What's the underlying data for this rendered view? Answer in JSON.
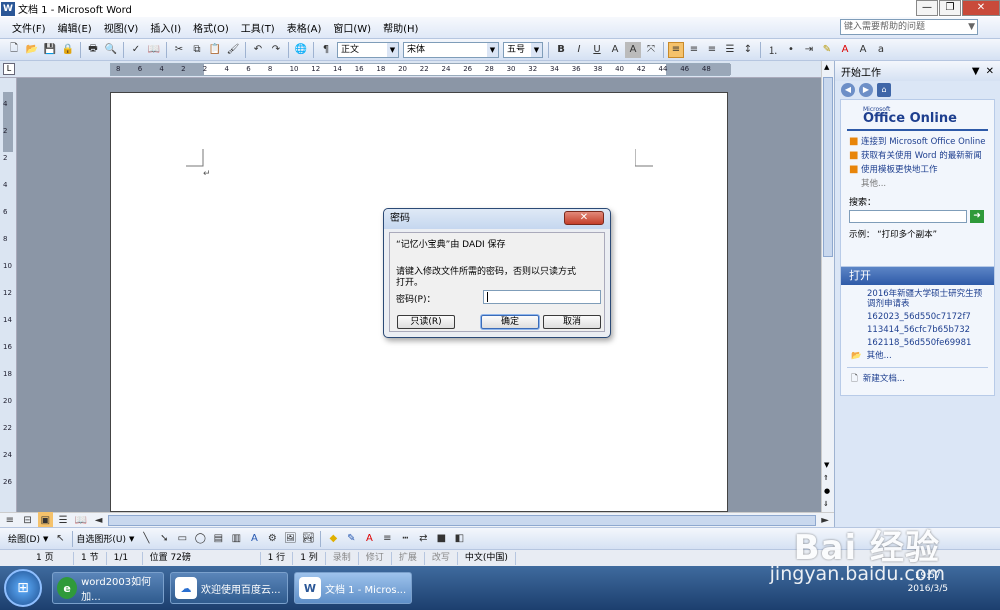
{
  "titlebar": {
    "icon_letter": "W",
    "title": "文档 1 - Microsoft Word"
  },
  "window_controls": {
    "minimize": "—",
    "restore": "❐",
    "close": "✕"
  },
  "menubar": {
    "items": [
      "文件(F)",
      "编辑(E)",
      "视图(V)",
      "插入(I)",
      "格式(O)",
      "工具(T)",
      "表格(A)",
      "窗口(W)",
      "帮助(H)"
    ],
    "help_placeholder": "键入需要帮助的问题"
  },
  "formatting": {
    "style": "正文",
    "font": "宋体",
    "size": "五号"
  },
  "ruler": {
    "h_ticks": [
      "8",
      "6",
      "4",
      "2",
      "2",
      "4",
      "6",
      "8",
      "10",
      "12",
      "14",
      "16",
      "18",
      "20",
      "22",
      "24",
      "26",
      "28",
      "30",
      "32",
      "34",
      "36",
      "38",
      "40",
      "42",
      "44",
      "46",
      "48"
    ]
  },
  "dialog": {
    "title": "密码",
    "line1": "“记忆小宝典”由 DADI 保存",
    "line2": "请键入修改文件所需的密码，否则以只读方式",
    "line3": "打开。",
    "password_label": "密码(P)：",
    "password_value": "",
    "readonly_button": "只读(R)",
    "ok_button": "确定",
    "cancel_button": "取消"
  },
  "taskpane": {
    "title": "开始工作",
    "office_brand_small": "Microsoft",
    "office_brand": "Office Online",
    "links": [
      "连接到 Microsoft Office Online",
      "获取有关使用 Word 的最新新闻",
      "使用模板更快地工作"
    ],
    "more": "其他...",
    "search_label": "搜索：",
    "example": "示例：  “打印多个副本”",
    "open_header": "打开",
    "recent_files": [
      "2016年新疆大学硕士研究生预调剂申请表",
      "162023_56d550c7172f7",
      "113414_56cfc7b65b732",
      "162118_56d550fe69981"
    ],
    "open_more": "其他...",
    "new_doc": "新建文档..."
  },
  "drawbar": {
    "draw": "绘图(D)",
    "autoshapes": "自选图形(U)"
  },
  "statusbar": {
    "page": "1 页",
    "section": "1 节",
    "pages": "1/1",
    "position": "位置 72磅",
    "line": "1 行",
    "col": "1 列",
    "rec": "录制",
    "trk": "修订",
    "ext": "扩展",
    "ovr": "改写",
    "lang": "中文(中国)"
  },
  "taskbar": {
    "tasks": [
      "word2003如何加...",
      "欢迎使用百度云...",
      "文档 1 - Micros..."
    ],
    "time": "19:57",
    "date": "2016/3/5"
  },
  "watermark": {
    "brand": "Bai 经验",
    "url": "jingyan.baidu.com"
  }
}
